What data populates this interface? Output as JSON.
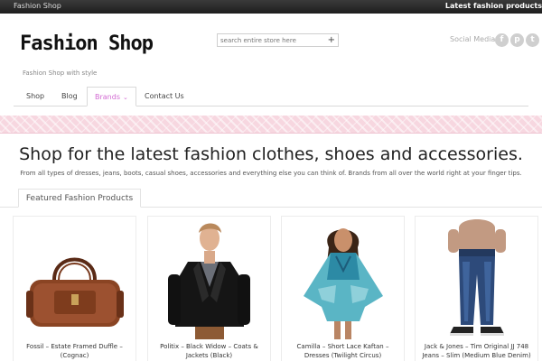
{
  "topbar": {
    "brand": "Fashion Shop",
    "promo": "Latest fashion products"
  },
  "logo": {
    "text": "Fashion Shop"
  },
  "tagline": "Fashion Shop with style",
  "search": {
    "placeholder": "search entire store here",
    "button_icon": "plus-icon"
  },
  "social": {
    "label": "Social Media:",
    "icons": [
      "facebook-icon",
      "pinterest-icon",
      "twitter-icon"
    ]
  },
  "nav": {
    "items": [
      {
        "label": "Shop"
      },
      {
        "label": "Blog"
      },
      {
        "label": "Brands",
        "active": true
      },
      {
        "label": "Contact Us"
      }
    ]
  },
  "hero": {
    "headline": "Shop for the latest fashion clothes, shoes and accessories.",
    "subline": "From all types of dresses, jeans, boots, casual shoes, accessories and everything else you can think of. Brands from all over the world right at your finger tips."
  },
  "featured": {
    "tab_label": "Featured Fashion Products"
  },
  "products": [
    {
      "title": "Fossil – Estate Framed Duffle – (Cognac)"
    },
    {
      "title": "Politix – Black Widow – Coats & Jackets (Black)"
    },
    {
      "title": "Camilla – Short Lace Kaftan – Dresses (Twilight Circus)"
    },
    {
      "title": "Jack & Jones – Tim Original JJ 748 Jeans – Slim (Medium Blue Denim)"
    }
  ],
  "colors": {
    "accent": "#d26ad2",
    "banner": "#f7d7e0",
    "topbar": "#262626"
  }
}
